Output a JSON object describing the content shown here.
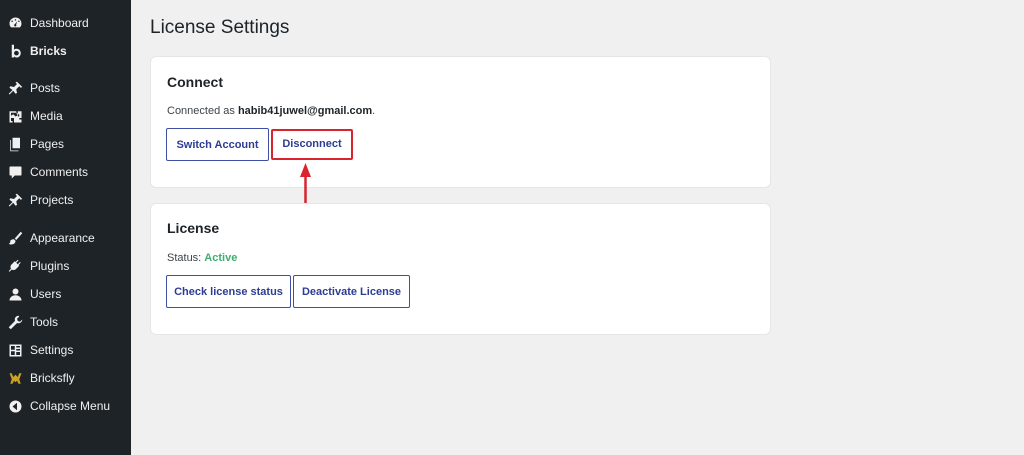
{
  "sidebar": {
    "items": [
      {
        "label": "Dashboard",
        "icon": "dashboard-icon"
      },
      {
        "label": "Bricks",
        "icon": "bricks-icon"
      },
      {
        "label": "Posts",
        "icon": "pin-icon"
      },
      {
        "label": "Media",
        "icon": "media-icon"
      },
      {
        "label": "Pages",
        "icon": "pages-icon"
      },
      {
        "label": "Comments",
        "icon": "comment-icon"
      },
      {
        "label": "Projects",
        "icon": "pin-icon"
      },
      {
        "label": "Appearance",
        "icon": "brush-icon"
      },
      {
        "label": "Plugins",
        "icon": "plug-icon"
      },
      {
        "label": "Users",
        "icon": "user-icon"
      },
      {
        "label": "Tools",
        "icon": "wrench-icon"
      },
      {
        "label": "Settings",
        "icon": "settings-icon"
      },
      {
        "label": "Bricksfly",
        "icon": "bricksfly-icon"
      },
      {
        "label": "Collapse Menu",
        "icon": "collapse-icon"
      }
    ]
  },
  "page": {
    "title": "License Settings"
  },
  "connect": {
    "title": "Connect",
    "connected_prefix": "Connected as ",
    "email": "habib41juwel@gmail.com",
    "suffix": ".",
    "switch_label": "Switch Account",
    "disconnect_label": "Disconnect"
  },
  "license": {
    "title": "License",
    "status_prefix": "Status: ",
    "status_value": "Active",
    "check_label": "Check license status",
    "deactivate_label": "Deactivate License"
  },
  "colors": {
    "sidebar_bg": "#1d2327",
    "page_bg": "#f0f0f1",
    "button_text": "#2e3c93",
    "active_status": "#3fae6f",
    "annotation_red": "#d9232e"
  }
}
